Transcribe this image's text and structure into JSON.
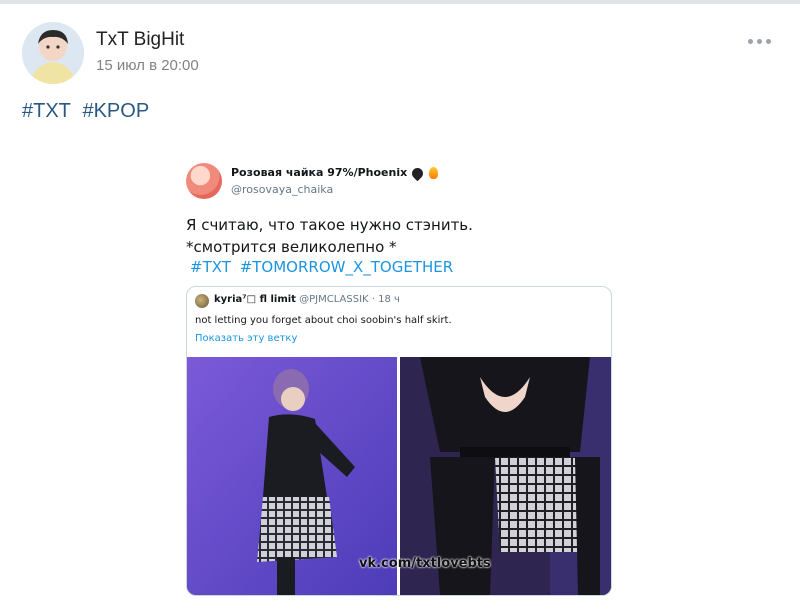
{
  "post": {
    "author": "TxT BigHit",
    "date": "15 июл в 20:00",
    "hashtags": [
      "#TXT",
      "#KPOP"
    ]
  },
  "icons": {
    "avatar": "avatar",
    "more": "more-dots-icon"
  },
  "tweet": {
    "name": "Розовая чайка 97%/Phoenix",
    "handle": "@rosovaya_chaika",
    "text_lines": [
      "Я считаю, что такое нужно стэнить.",
      "*смотрится великолепно *"
    ],
    "hashtags": [
      "#TXT",
      "#TOMORROW_X_TOGETHER"
    ],
    "quote": {
      "name": "kyria⁷□ fl limit",
      "handle": "@PJMCLASSIK",
      "time": "· 18 ч",
      "text": "not letting you forget about choi soobin's half skirt.",
      "link": "Показать эту ветку"
    }
  },
  "watermark": "vk.com/txtlovebts",
  "colors": {
    "link": "#2a5885",
    "twitter_blue": "#1b95e0",
    "muted": "#828282"
  }
}
